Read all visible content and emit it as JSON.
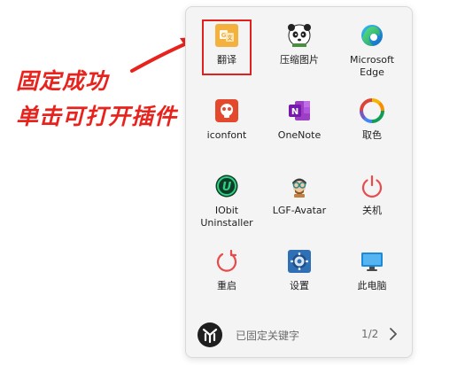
{
  "annotation": {
    "line1": "固定成功",
    "line2": "单击可打开插件",
    "color": "#e8221c"
  },
  "tiles": [
    {
      "label": "翻译",
      "icon": "translate-icon"
    },
    {
      "label": "压缩图片",
      "icon": "panda-icon"
    },
    {
      "label": "Microsoft Edge",
      "icon": "edge-icon"
    },
    {
      "label": "iconfont",
      "icon": "iconfont-icon"
    },
    {
      "label": "OneNote",
      "icon": "onenote-icon"
    },
    {
      "label": "取色",
      "icon": "color-ring-icon"
    },
    {
      "label": "IObit Uninstaller",
      "icon": "iobit-icon"
    },
    {
      "label": "LGF-Avatar",
      "icon": "avatar-icon"
    },
    {
      "label": "关机",
      "icon": "power-icon"
    },
    {
      "label": "重启",
      "icon": "restart-icon"
    },
    {
      "label": "设置",
      "icon": "settings-icon"
    },
    {
      "label": "此电脑",
      "icon": "computer-icon"
    }
  ],
  "footer": {
    "text": "已固定关键字",
    "page": "1/2"
  }
}
